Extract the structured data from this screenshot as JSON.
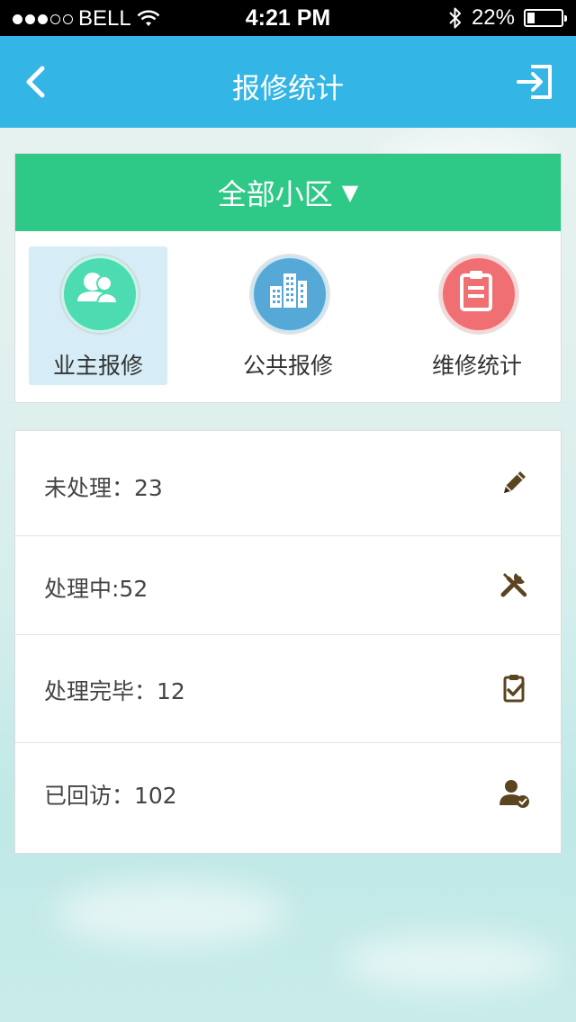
{
  "status_bar": {
    "carrier": "BELL",
    "time": "4:21 PM",
    "battery": "22%",
    "battery_level": 0.22,
    "signal_bars": 3,
    "signal_total": 5
  },
  "nav": {
    "title": "报修统计",
    "back_icon": "chevron-left-icon",
    "exit_icon": "exit-icon"
  },
  "community": {
    "label": "全部小区",
    "arrow": "▼"
  },
  "categories": [
    {
      "label": "业主报修",
      "icon": "users-icon",
      "color": "#4ddbb2",
      "active": true
    },
    {
      "label": "公共报修",
      "icon": "building-icon",
      "color": "#56a8d6",
      "active": false
    },
    {
      "label": "维修统计",
      "icon": "clipboard-icon",
      "color": "#f06f72",
      "active": false
    }
  ],
  "stats": [
    {
      "label": "未处理：23",
      "icon": "pencil-icon"
    },
    {
      "label": "处理中:52",
      "icon": "tools-icon"
    },
    {
      "label": "处理完毕：12",
      "icon": "clipboard-check-icon"
    },
    {
      "label": "已回访：102",
      "icon": "user-check-icon"
    }
  ],
  "colors": {
    "nav": "#33b5e5",
    "community_bar": "#2ec987",
    "stat_icon": "#5a4520"
  }
}
